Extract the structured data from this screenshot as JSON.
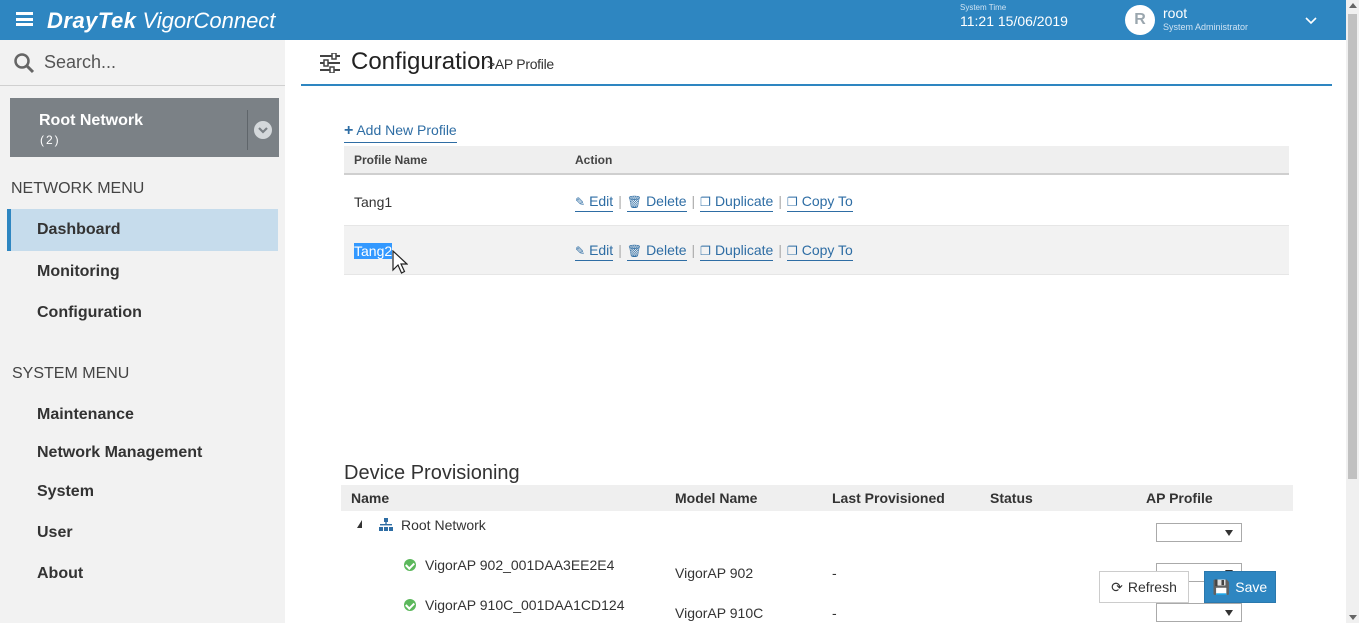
{
  "topbar": {
    "brand_main": "DrayTek",
    "brand_sub": "VigorConnect",
    "system_time_label": "System Time",
    "system_time": "11:21 15/06/2019",
    "avatar_letter": "R",
    "user_name": "root",
    "user_role": "System Administrator"
  },
  "sidebar": {
    "search_placeholder": "Search...",
    "root_network": {
      "title": "Root Network",
      "count": "(2)"
    },
    "network_menu_header": "NETWORK MENU",
    "network_items": [
      "Dashboard",
      "Monitoring",
      "Configuration"
    ],
    "active_item": "Dashboard",
    "system_menu_header": "SYSTEM MENU",
    "system_items": [
      "Maintenance",
      "Network Management",
      "System",
      "User",
      "About"
    ]
  },
  "main": {
    "title": "Configuration",
    "subtitle": ">AP Profile",
    "add_profile": "Add New Profile",
    "profile_table": {
      "columns": [
        "Profile Name",
        "Action"
      ],
      "rows": [
        {
          "name": "Tang1",
          "selected": false
        },
        {
          "name": "Tang2",
          "selected": true
        }
      ],
      "actions": [
        "Edit",
        "Delete",
        "Duplicate",
        "Copy To"
      ]
    },
    "device_provisioning": {
      "title": "Device Provisioning",
      "columns": [
        "Name",
        "Model Name",
        "Last Provisioned",
        "Status",
        "AP Profile"
      ],
      "root": "Root Network",
      "devices": [
        {
          "name": "VigorAP 902_001DAA3EE2E4",
          "model": "VigorAP 902",
          "last": "-"
        },
        {
          "name": "VigorAP 910C_001DAA1CD124",
          "model": "VigorAP 910C",
          "last": "-"
        }
      ]
    },
    "buttons": {
      "refresh": "Refresh",
      "save": "Save"
    }
  },
  "colors": {
    "brand_blue": "#2e86c1",
    "link_blue": "#2e6da4",
    "status_green": "#5cb85c"
  }
}
